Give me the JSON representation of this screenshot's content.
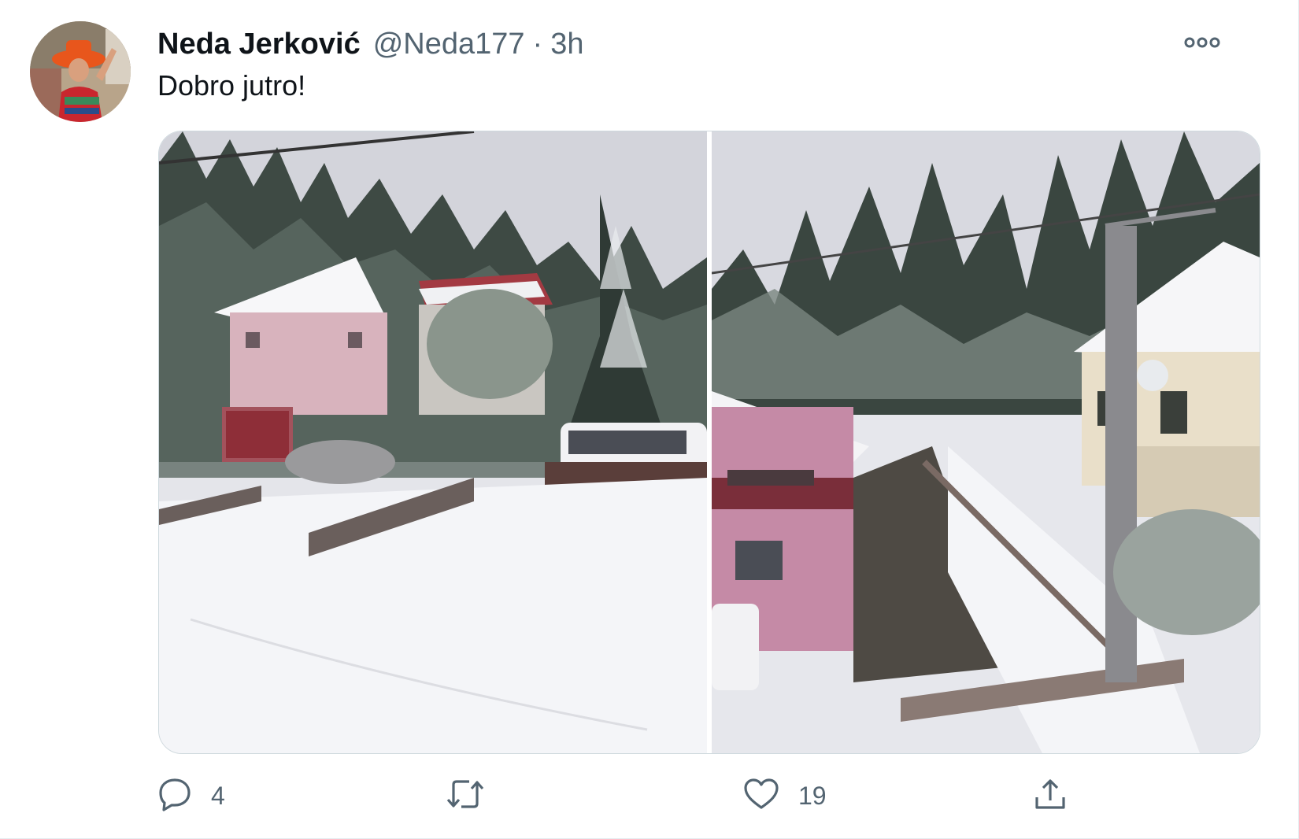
{
  "tweet": {
    "author": {
      "display_name": "Neda Jerković",
      "handle": "@Neda177",
      "separator": "·",
      "time_ago": "3h",
      "avatar_icon": "user-avatar-photo"
    },
    "text": "Dobro jutro!",
    "media": [
      {
        "icon": "snowy-village-photo-left"
      },
      {
        "icon": "snowy-village-photo-right"
      }
    ],
    "actions": {
      "reply_count": "4",
      "retweet_count": "",
      "like_count": "19"
    }
  },
  "colors": {
    "text_primary": "#0f1419",
    "text_secondary": "#536471",
    "border": "#cfd9de"
  }
}
